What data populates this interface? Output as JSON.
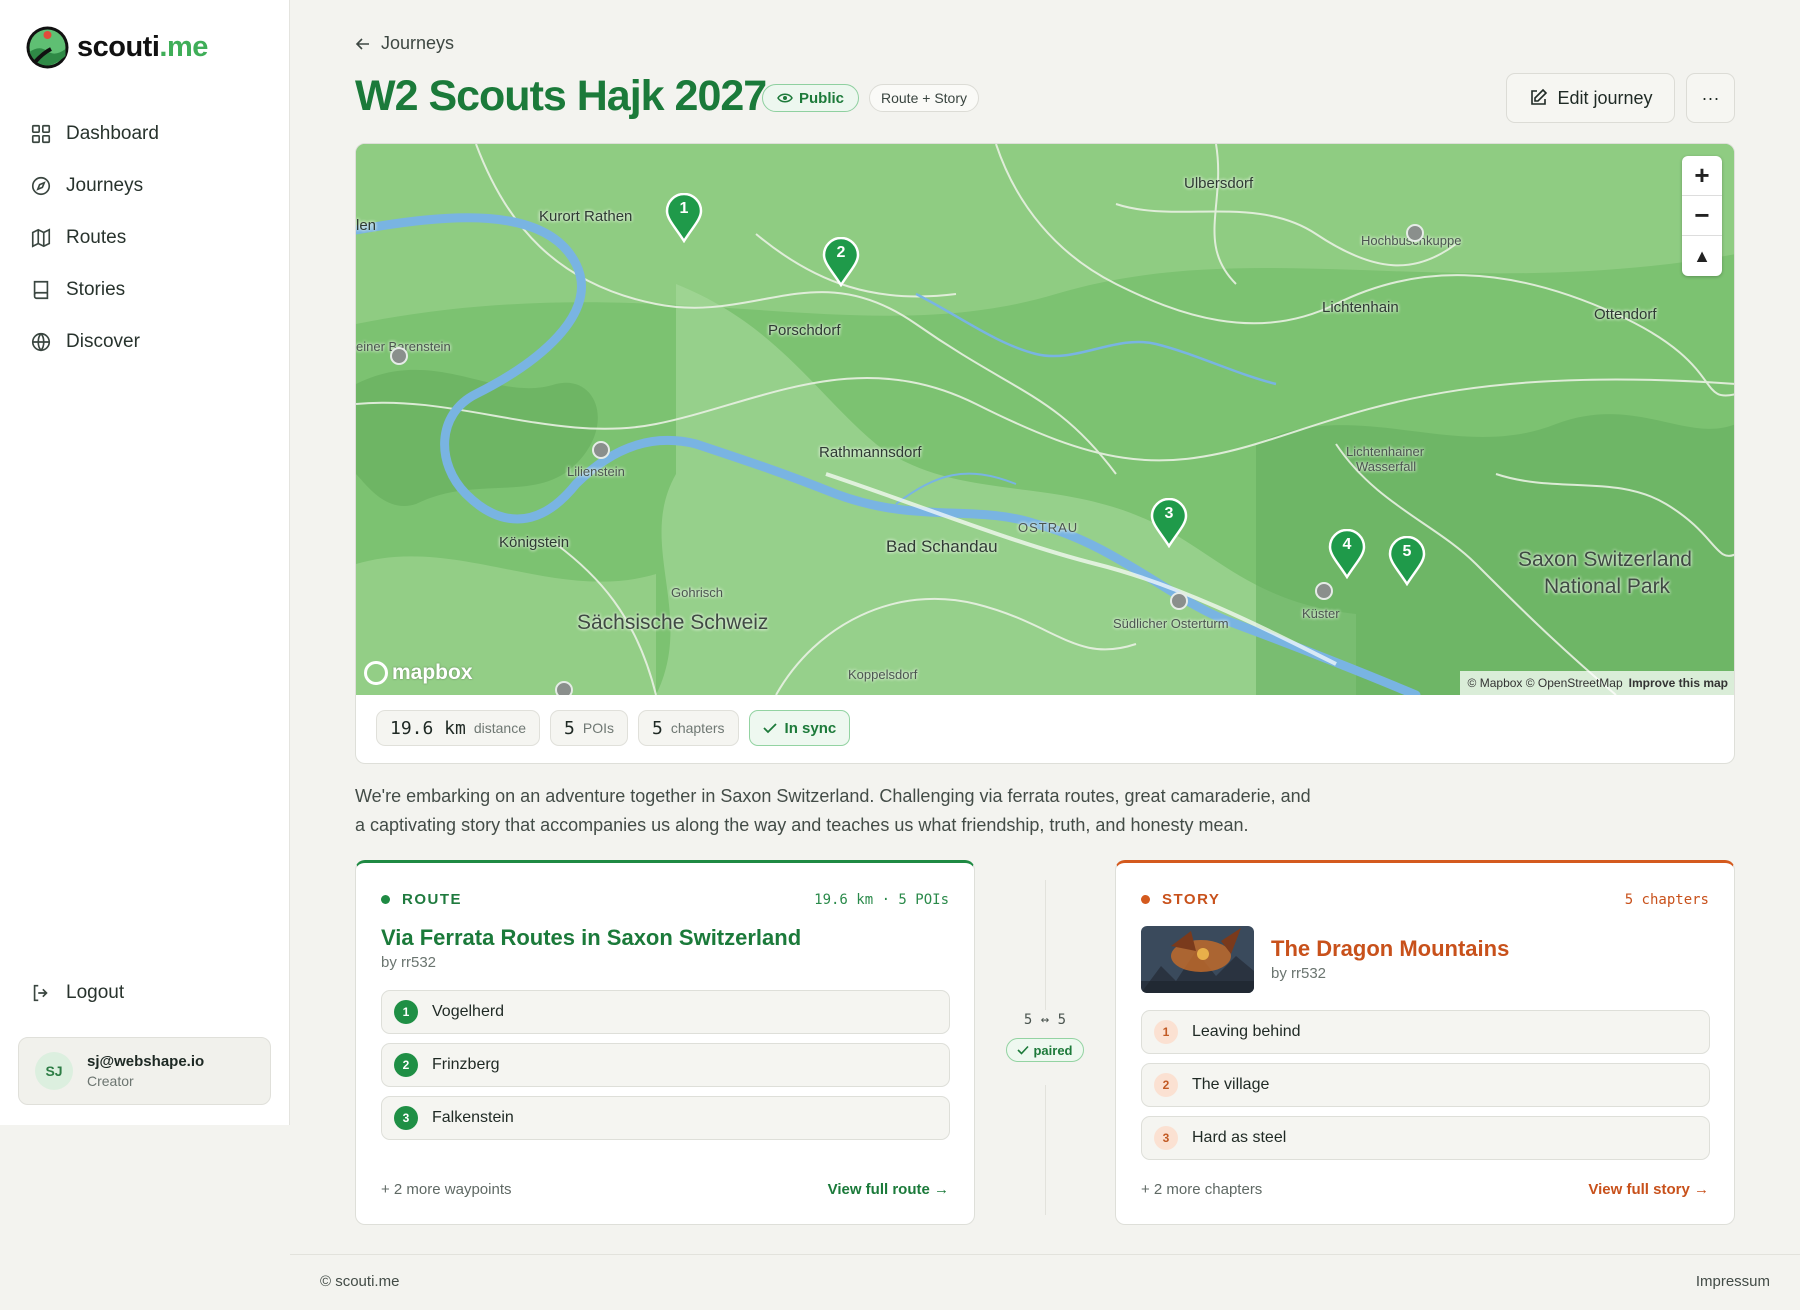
{
  "brand": {
    "name_main": "scouti",
    "name_suffix": ".me"
  },
  "nav": [
    {
      "label": "Dashboard",
      "icon": "grid-icon"
    },
    {
      "label": "Journeys",
      "icon": "compass-icon"
    },
    {
      "label": "Routes",
      "icon": "map-icon"
    },
    {
      "label": "Stories",
      "icon": "book-icon"
    },
    {
      "label": "Discover",
      "icon": "globe-icon"
    }
  ],
  "logout_label": "Logout",
  "user": {
    "initials": "SJ",
    "email": "sj@webshape.io",
    "role": "Creator"
  },
  "header": {
    "back_label": "Journeys",
    "title": "W2 Scouts Hajk 2027",
    "visibility": "Public",
    "type": "Route + Story",
    "edit_label": "Edit journey",
    "more_label": "···"
  },
  "map": {
    "labels": {
      "kurort_rathen": "Kurort Rathen",
      "ulbersdorf": "Ulbersdorf",
      "hochbuschkuppe": "Hochbuschkuppe",
      "len": "len",
      "porschdorf": "Porschdorf",
      "lichtenhain": "Lichtenhain",
      "ottendorf": "Ottendorf",
      "barenstein": "einer Barenstein",
      "lilienstein": "Lilienstein",
      "rathmannsdorf": "Rathmannsdorf",
      "lichtenhainer": "Lichtenhainer",
      "wasserfall": "Wasserfall",
      "ostrau": "OSTRAU",
      "konigstein": "Königstein",
      "bad_schandau": "Bad Schandau",
      "np1": "Saxon Switzerland",
      "np2": "National Park",
      "gohrisch": "Gohrisch",
      "sachsische": "Sächsische Schweiz",
      "ostertum": "Südlicher Osterturm",
      "kuster": "Küster",
      "koppelsdorf": "Koppelsdorf"
    },
    "pins": [
      "1",
      "2",
      "3",
      "4",
      "5"
    ],
    "zoom_in": "+",
    "zoom_out": "−",
    "compass": "▲",
    "logo": "mapbox",
    "attribution": "© Mapbox © OpenStreetMap",
    "improve": "Improve this map"
  },
  "stats": {
    "distance_value": "19.6 km",
    "distance_label": "distance",
    "pois_value": "5",
    "pois_label": "POIs",
    "chapters_value": "5",
    "chapters_label": "chapters",
    "sync_label": "In sync"
  },
  "description": "We're embarking on an adventure together in Saxon Switzerland. Challenging via ferrata routes, great camaraderie, and a captivating story that accompanies us along the way and teaches us what friendship, truth, and honesty mean.",
  "route": {
    "heading": "ROUTE",
    "meta": "19.6 km · 5 POIs",
    "title": "Via Ferrata Routes in Saxon Switzerland",
    "by": "by rr532",
    "waypoints": [
      {
        "num": "1",
        "name": "Vogelherd"
      },
      {
        "num": "2",
        "name": "Frinzberg"
      },
      {
        "num": "3",
        "name": "Falkenstein"
      }
    ],
    "more": "+ 2 more waypoints",
    "view": "View full route →"
  },
  "pairing": {
    "count": "5 ↔ 5",
    "badge": "paired"
  },
  "story": {
    "heading": "STORY",
    "meta": "5 chapters",
    "title": "The Dragon Mountains",
    "by": "by rr532",
    "chapters": [
      {
        "num": "1",
        "name": "Leaving behind"
      },
      {
        "num": "2",
        "name": "The village"
      },
      {
        "num": "3",
        "name": "Hard as steel"
      }
    ],
    "more": "+ 2 more chapters",
    "view": "View full story →"
  },
  "footer": {
    "copyright": "© scouti.me",
    "impressum": "Impressum"
  },
  "colors": {
    "brand_green": "#1b7a3a",
    "story_orange": "#c8511b",
    "pin_green": "#1f9a4a"
  }
}
